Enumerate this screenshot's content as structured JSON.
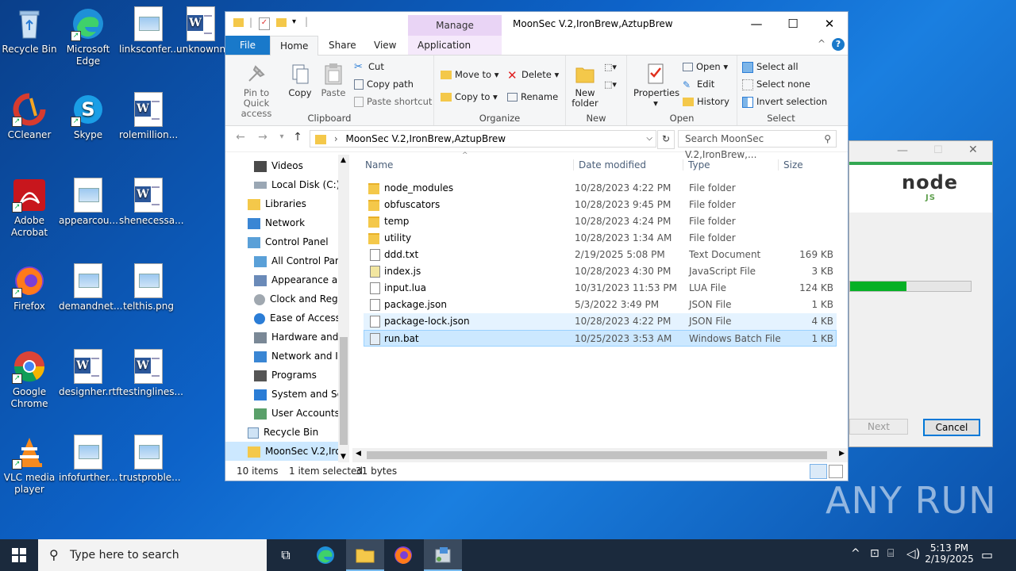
{
  "desktop": {
    "icons": [
      {
        "label": "Recycle Bin"
      },
      {
        "label": "Microsoft Edge"
      },
      {
        "label": "linksconfer..."
      },
      {
        "label": "unknownn"
      },
      {
        "label": "CCleaner"
      },
      {
        "label": "Skype"
      },
      {
        "label": "rolemillion..."
      },
      {
        "label": "Adobe Acrobat"
      },
      {
        "label": "appearcou..."
      },
      {
        "label": "shenecessa..."
      },
      {
        "label": "Firefox"
      },
      {
        "label": "demandnet..."
      },
      {
        "label": "telthis.png"
      },
      {
        "label": "Google Chrome"
      },
      {
        "label": "designher.rtf"
      },
      {
        "label": "testinglines..."
      },
      {
        "label": "VLC media player"
      },
      {
        "label": "infofurther..."
      },
      {
        "label": "trustproble..."
      }
    ]
  },
  "explorer": {
    "title": "MoonSec V.2,IronBrew,AztupBrew",
    "manage_tab": "Manage",
    "controls": {
      "minimize": "—",
      "maximize": "☐",
      "close": "✕"
    },
    "tabs": {
      "file": "File",
      "home": "Home",
      "share": "Share",
      "view": "View",
      "app_tools": "Application Tools"
    },
    "ribbon": {
      "clipboard": {
        "label": "Clipboard",
        "pin": "Pin to Quick access",
        "copy": "Copy",
        "paste": "Paste",
        "cut": "Cut",
        "copy_path": "Copy path",
        "paste_shortcut": "Paste shortcut"
      },
      "organize": {
        "label": "Organize",
        "move_to": "Move to",
        "copy_to": "Copy to",
        "delete": "Delete",
        "rename": "Rename"
      },
      "new": {
        "label": "New",
        "new_folder": "New folder"
      },
      "open": {
        "label": "Open",
        "properties": "Properties",
        "open": "Open",
        "edit": "Edit",
        "history": "History"
      },
      "select": {
        "label": "Select",
        "select_all": "Select all",
        "select_none": "Select none",
        "invert": "Invert selection"
      }
    },
    "address": "MoonSec V.2,IronBrew,AztupBrew",
    "search_placeholder": "Search MoonSec V.2,IronBrew,...",
    "nav_items": [
      {
        "label": "Videos"
      },
      {
        "label": "Local Disk (C:)"
      },
      {
        "label": "Libraries"
      },
      {
        "label": "Network"
      },
      {
        "label": "Control Panel"
      },
      {
        "label": "All Control Par"
      },
      {
        "label": "Appearance an"
      },
      {
        "label": "Clock and Regi"
      },
      {
        "label": "Ease of Access"
      },
      {
        "label": "Hardware and"
      },
      {
        "label": "Network and In"
      },
      {
        "label": "Programs"
      },
      {
        "label": "System and Sec"
      },
      {
        "label": "User Accounts"
      },
      {
        "label": "Recycle Bin"
      },
      {
        "label": "MoonSec V.2,Iro"
      }
    ],
    "columns": {
      "name": "Name",
      "date": "Date modified",
      "type": "Type",
      "size": "Size"
    },
    "files": [
      {
        "name": "node_modules",
        "date": "10/28/2023 4:22 PM",
        "type": "File folder",
        "size": ""
      },
      {
        "name": "obfuscators",
        "date": "10/28/2023 9:45 PM",
        "type": "File folder",
        "size": ""
      },
      {
        "name": "temp",
        "date": "10/28/2023 4:24 PM",
        "type": "File folder",
        "size": ""
      },
      {
        "name": "utility",
        "date": "10/28/2023 1:34 AM",
        "type": "File folder",
        "size": ""
      },
      {
        "name": "ddd.txt",
        "date": "2/19/2025 5:08 PM",
        "type": "Text Document",
        "size": "169 KB"
      },
      {
        "name": "index.js",
        "date": "10/28/2023 4:30 PM",
        "type": "JavaScript File",
        "size": "3 KB"
      },
      {
        "name": "input.lua",
        "date": "10/31/2023 11:53 PM",
        "type": "LUA File",
        "size": "124 KB"
      },
      {
        "name": "package.json",
        "date": "5/3/2022 3:49 PM",
        "type": "JSON File",
        "size": "1 KB"
      },
      {
        "name": "package-lock.json",
        "date": "10/28/2023 4:22 PM",
        "type": "JSON File",
        "size": "4 KB"
      },
      {
        "name": "run.bat",
        "date": "10/25/2023 3:53 AM",
        "type": "Windows Batch File",
        "size": "1 KB"
      }
    ],
    "status": {
      "count": "10 items",
      "selected": "1 item selected",
      "bytes": "31 bytes"
    }
  },
  "installer": {
    "logo": "node",
    "logo_sub": "JS",
    "progress": 0.47,
    "next": "Next",
    "cancel": "Cancel"
  },
  "taskbar": {
    "search_placeholder": "Type here to search",
    "time": "5:13 PM",
    "date": "2/19/2025"
  },
  "watermark": "ANY RUN"
}
